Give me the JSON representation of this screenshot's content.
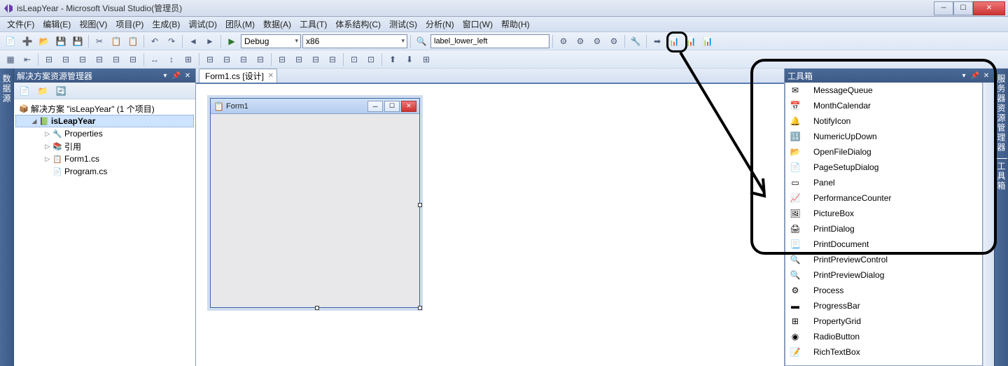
{
  "window": {
    "title": "isLeapYear - Microsoft Visual Studio(管理员)"
  },
  "menu": {
    "items": [
      "文件(F)",
      "编辑(E)",
      "视图(V)",
      "项目(P)",
      "生成(B)",
      "调试(D)",
      "团队(M)",
      "数据(A)",
      "工具(T)",
      "体系结构(C)",
      "测试(S)",
      "分析(N)",
      "窗口(W)",
      "帮助(H)"
    ]
  },
  "toolbar": {
    "config": "Debug",
    "platform": "x86",
    "find_text": "label_lower_left"
  },
  "solution_explorer": {
    "title": "解决方案资源管理器",
    "solution": "解决方案 \"isLeapYear\" (1 个项目)",
    "project": "isLeapYear",
    "nodes": {
      "properties": "Properties",
      "references": "引用",
      "form1": "Form1.cs",
      "program": "Program.cs"
    }
  },
  "document": {
    "tab": "Form1.cs [设计]",
    "form_title": "Form1"
  },
  "toolbox": {
    "title": "工具箱",
    "items": [
      {
        "icon": "msgq",
        "label": "MessageQueue"
      },
      {
        "icon": "cal",
        "label": "MonthCalendar"
      },
      {
        "icon": "notify",
        "label": "NotifyIcon"
      },
      {
        "icon": "numeric",
        "label": "NumericUpDown"
      },
      {
        "icon": "openfile",
        "label": "OpenFileDialog"
      },
      {
        "icon": "pagesetup",
        "label": "PageSetupDialog"
      },
      {
        "icon": "panel",
        "label": "Panel"
      },
      {
        "icon": "perf",
        "label": "PerformanceCounter"
      },
      {
        "icon": "pic",
        "label": "PictureBox"
      },
      {
        "icon": "printdlg",
        "label": "PrintDialog"
      },
      {
        "icon": "printdoc",
        "label": "PrintDocument"
      },
      {
        "icon": "ppctrl",
        "label": "PrintPreviewControl"
      },
      {
        "icon": "ppdlg",
        "label": "PrintPreviewDialog"
      },
      {
        "icon": "process",
        "label": "Process"
      },
      {
        "icon": "progress",
        "label": "ProgressBar"
      },
      {
        "icon": "propgrid",
        "label": "PropertyGrid"
      },
      {
        "icon": "radio",
        "label": "RadioButton"
      },
      {
        "icon": "richtext",
        "label": "RichTextBox"
      }
    ]
  },
  "side_tabs": {
    "left": "数据源",
    "right1": "服务器资源管理器",
    "right2": "工具箱"
  }
}
